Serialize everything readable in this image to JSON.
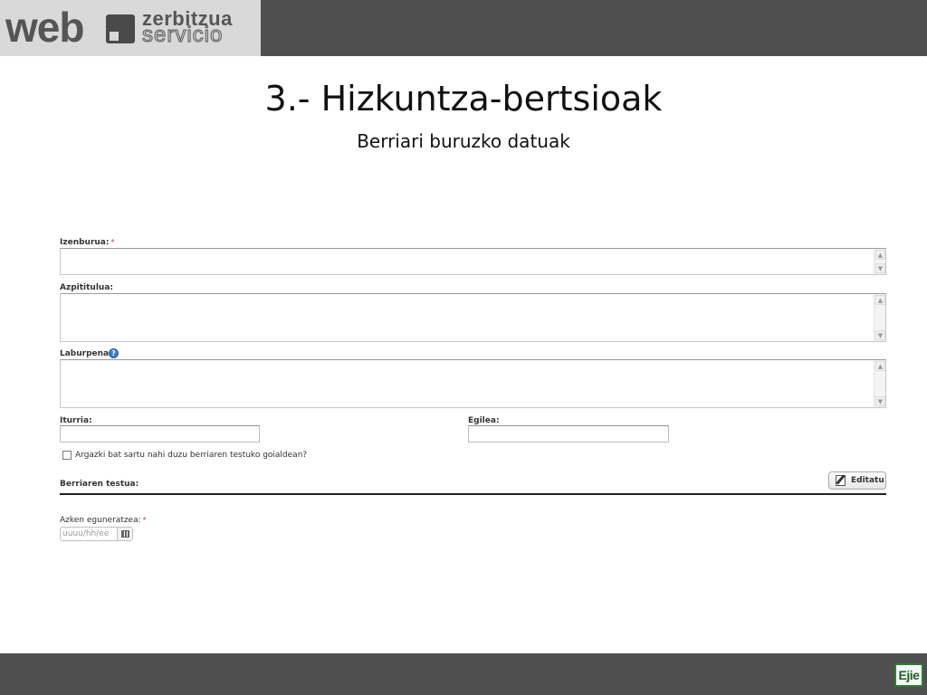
{
  "logo": {
    "brand_word": "web",
    "line1": "zerbitzua",
    "line2": "servicio"
  },
  "slide": {
    "title": "3.- Hizkuntza-bertsioak",
    "subtitle": "Berriari buruzko datuak"
  },
  "form": {
    "required_mark": "*",
    "fields": {
      "izenburua": {
        "label": "Izenburua:",
        "value": "",
        "required": true
      },
      "azpititulua": {
        "label": "Azpititulua:",
        "value": ""
      },
      "laburpena": {
        "label": "Laburpena:",
        "value": "",
        "help_icon": "question-icon"
      },
      "iturria": {
        "label": "Iturria:",
        "value": ""
      },
      "egilea": {
        "label": "Egilea:",
        "value": ""
      }
    },
    "image_checkbox": {
      "label": "Argazki bat sartu nahi duzu berriaren testuko goialdean?",
      "checked": false
    },
    "body_text": {
      "label": "Berriaren testua:"
    },
    "edit_button": {
      "label": "Editatu",
      "icon": "edit-icon"
    },
    "last_update": {
      "label": "Azken eguneratzea:",
      "required": true,
      "placeholder": "uuuu/hh/ee",
      "icon": "calendar-icon"
    }
  },
  "footer": {
    "logo_text": "Ejie"
  },
  "colors": {
    "bar": "#4f4f4f",
    "logo_bg": "#d9d9d9",
    "required": "#dd3333",
    "help": "#3b7bc8",
    "ejie_green": "#2e7d32"
  }
}
